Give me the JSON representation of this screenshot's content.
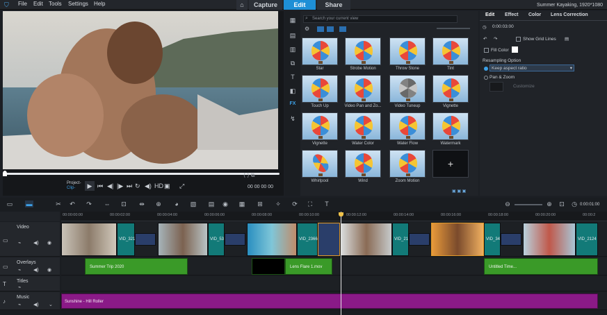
{
  "menu": [
    "File",
    "Edit",
    "Tools",
    "Settings",
    "Help"
  ],
  "modes": [
    {
      "label": "Capture"
    },
    {
      "label": "Edit"
    },
    {
      "label": "Share"
    }
  ],
  "project_title": "Summer Kayaking, 1920*1080",
  "player": {
    "mode_label": "Project-",
    "mode_sub": "Clip-",
    "timecode": "00 00 00 00"
  },
  "library": {
    "search_placeholder": "Search your current view",
    "items": [
      "Star",
      "Strobe Motion",
      "Throw Stone",
      "Tint",
      "Touch Up",
      "Video Pan and Zo...",
      "Video Tuneup",
      "Vignette",
      "Vignette",
      "Water Color",
      "Water Flow",
      "Watermark",
      "Whirlpool",
      "Wind",
      "Zoom Motion"
    ]
  },
  "options": {
    "tabs": [
      "Edit",
      "Effect",
      "Color",
      "Lens Correction"
    ],
    "duration": "0:00:03:00",
    "show_grid_lines": "Show Grid Lines",
    "fill_color": "Fill Color",
    "resampling_label": "Resampling Option",
    "resampling_value": "Keep aspect ratio",
    "pan_zoom": "Pan & Zoom",
    "customize": "Customize"
  },
  "timeline": {
    "zoom_time": "0:00:01:00",
    "ruler": [
      "00:00:00:00",
      "00:00:02:00",
      "00:00:04:00",
      "00:00:06:00",
      "00:00:08:00",
      "00:00:10:00",
      "00:00:12:00",
      "00:00:14:00",
      "00:00:16:00",
      "00:00:18:00",
      "00:00:20:00",
      "00:00:2"
    ],
    "tracks": [
      "Video",
      "Overlays",
      "Titles",
      "Music"
    ],
    "video_clips": [
      "VID_321",
      "VID_53",
      "VID_2366",
      "VID_21",
      "VID_34",
      "VID_2124"
    ],
    "overlay_clips": [
      "Summer Trip 2020",
      "Lens Flare 1.mov",
      "Untitled Time..."
    ],
    "music_clip": "Sunshine - Hill Roller"
  }
}
